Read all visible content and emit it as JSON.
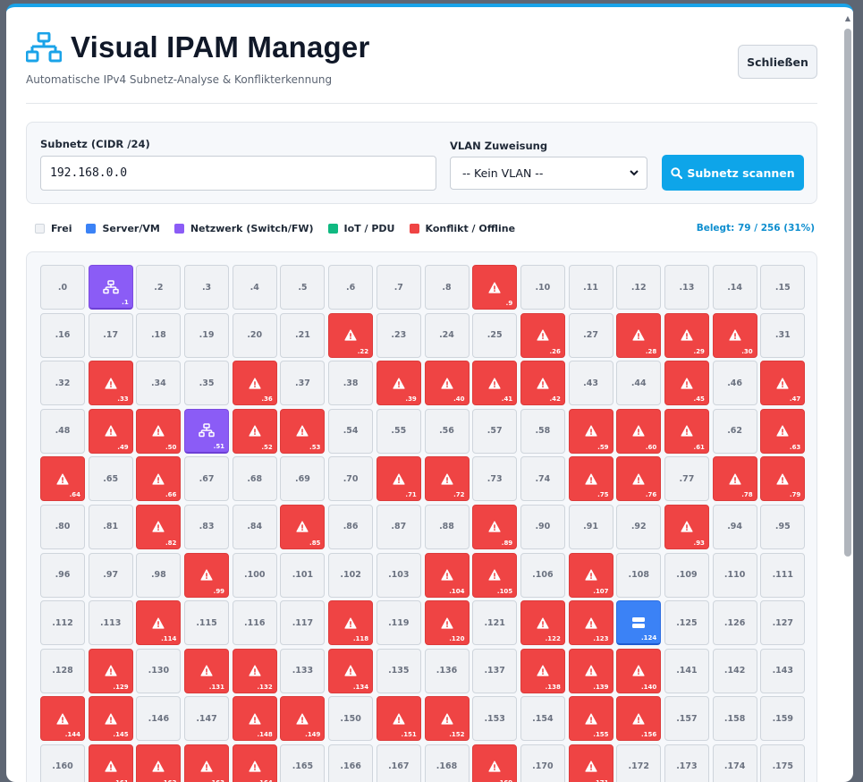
{
  "app": {
    "title": "Visual IPAM Manager",
    "subtitle": "Automatische IPv4 Subnetz-Analyse & Konflikterkennung",
    "close_label": "Schließen"
  },
  "form": {
    "subnet_label": "Subnetz (CIDR /24)",
    "subnet_value": "192.168.0.0",
    "vlan_label": "VLAN Zuweisung",
    "vlan_selected": "-- Kein VLAN --",
    "scan_label": "Subnetz scannen"
  },
  "legend": {
    "free": "Frei",
    "server": "Server/VM",
    "network": "Netzwerk (Switch/FW)",
    "iot": "IoT / PDU",
    "conflict": "Konflikt / Offline",
    "occupancy": "Belegt: 79 / 256 (31%)"
  },
  "colors": {
    "accent": "#0ea5e9",
    "free": "#f0f2f5",
    "server": "#3b82f6",
    "network": "#8b5cf6",
    "iot": "#10b981",
    "conflict": "#ef4444"
  },
  "grid": {
    "visible_cells": 176,
    "conflicts": [
      9,
      22,
      26,
      28,
      29,
      30,
      33,
      36,
      39,
      40,
      41,
      42,
      45,
      47,
      49,
      50,
      52,
      53,
      59,
      60,
      61,
      63,
      64,
      66,
      71,
      72,
      75,
      76,
      78,
      79,
      82,
      85,
      89,
      93,
      99,
      104,
      105,
      107,
      114,
      118,
      120,
      122,
      123,
      129,
      131,
      132,
      134,
      138,
      139,
      140,
      144,
      145,
      148,
      149,
      151,
      152,
      155,
      156,
      161,
      162,
      163,
      164,
      169,
      171
    ],
    "network": [
      1,
      51
    ],
    "server": [
      124
    ],
    "iot": []
  }
}
